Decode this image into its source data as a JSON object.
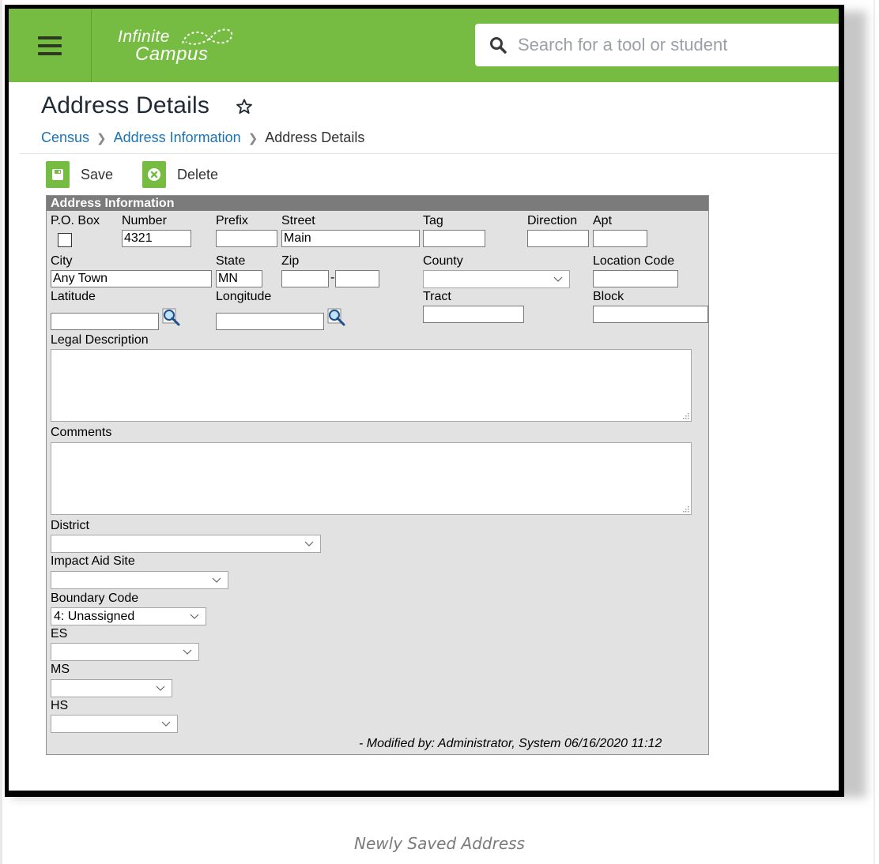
{
  "header": {
    "logo_line1": "Infinite",
    "logo_line2": "Campus",
    "search_placeholder": "Search for a tool or student"
  },
  "page": {
    "title": "Address Details",
    "breadcrumb": [
      "Census",
      "Address Information",
      "Address Details"
    ]
  },
  "toolbar": {
    "save_label": "Save",
    "delete_label": "Delete"
  },
  "form": {
    "section_title": "Address Information",
    "labels": {
      "po_box": "P.O. Box",
      "number": "Number",
      "prefix": "Prefix",
      "street": "Street",
      "tag": "Tag",
      "direction": "Direction",
      "apt": "Apt",
      "city": "City",
      "state": "State",
      "zip": "Zip",
      "county": "County",
      "location_code": "Location Code",
      "latitude": "Latitude",
      "longitude": "Longitude",
      "tract": "Tract",
      "block": "Block",
      "legal_description": "Legal Description",
      "comments": "Comments",
      "district": "District",
      "impact_aid_site": "Impact Aid Site",
      "boundary_code": "Boundary Code",
      "es": "ES",
      "ms": "MS",
      "hs": "HS"
    },
    "values": {
      "po_box_checked": false,
      "number": "4321",
      "prefix": "",
      "street": "Main",
      "tag": "",
      "direction": "",
      "apt": "",
      "city": "Any Town",
      "state": "MN",
      "zip": "",
      "zip4": "",
      "zip_separator": "-",
      "county": "",
      "location_code": "",
      "latitude": "",
      "longitude": "",
      "tract": "",
      "block": "",
      "district": "",
      "impact_aid_site": "",
      "boundary_code": "4: Unassigned",
      "es": "",
      "ms": "",
      "hs": ""
    },
    "modified_text": "- Modified by: Administrator, System 06/16/2020 11:12"
  },
  "caption": "Newly Saved Address",
  "colors": {
    "brand_green": "#76bc43",
    "link_blue": "#1a73b6",
    "panel_header": "#7b7b7b",
    "panel_bg": "#e2e2e2"
  }
}
